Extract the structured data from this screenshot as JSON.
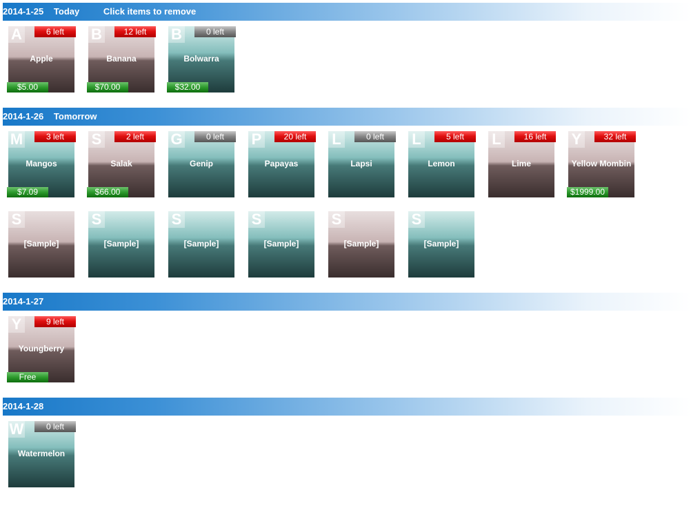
{
  "header": {
    "hint": "Click items to remove"
  },
  "sections": [
    {
      "date": "2014-1-25",
      "label": "Today",
      "items": [
        {
          "letter": "A",
          "name": "Apple",
          "stock": "6 left",
          "price": "$5.00"
        },
        {
          "letter": "B",
          "name": "Banana",
          "stock": "12 left",
          "price": "$70.00"
        },
        {
          "letter": "B",
          "name": "Bolwarra",
          "stock": "0 left",
          "price": "$32.00"
        }
      ]
    },
    {
      "date": "2014-1-26",
      "label": "Tomorrow",
      "items": [
        {
          "letter": "M",
          "name": "Mangos",
          "stock": "3 left",
          "price": "$7.09"
        },
        {
          "letter": "S",
          "name": "Salak",
          "stock": "2 left",
          "price": "$66.00"
        },
        {
          "letter": "G",
          "name": "Genip",
          "stock": "0 left"
        },
        {
          "letter": "P",
          "name": "Papayas",
          "stock": "20 left"
        },
        {
          "letter": "L",
          "name": "Lapsi",
          "stock": "0 left"
        },
        {
          "letter": "L",
          "name": "Lemon",
          "stock": "5 left"
        },
        {
          "letter": "L",
          "name": "Lime",
          "stock": "16 left"
        },
        {
          "letter": "Y",
          "name": "Yellow Mombin",
          "stock": "32 left",
          "price": "$1999.00"
        },
        {
          "letter": "S",
          "name": "[Sample]"
        },
        {
          "letter": "S",
          "name": "[Sample]"
        },
        {
          "letter": "S",
          "name": "[Sample]"
        },
        {
          "letter": "S",
          "name": "[Sample]"
        },
        {
          "letter": "S",
          "name": "[Sample]"
        },
        {
          "letter": "S",
          "name": "[Sample]"
        }
      ]
    },
    {
      "date": "2014-1-27",
      "items": [
        {
          "letter": "Y",
          "name": "Youngberry",
          "stock": "9 left",
          "price": "Free"
        }
      ]
    },
    {
      "date": "2014-1-28",
      "items": [
        {
          "letter": "W",
          "name": "Watermelon",
          "stock": "0 left"
        }
      ]
    }
  ],
  "colors": {
    "header_blue": "#1878c8",
    "stock_in_red": "#e01010",
    "stock_out_gray": "#8a8a8a",
    "price_green": "#2d9a2d",
    "tile_rose": "#6f5c5c",
    "tile_teal": "#477978"
  }
}
